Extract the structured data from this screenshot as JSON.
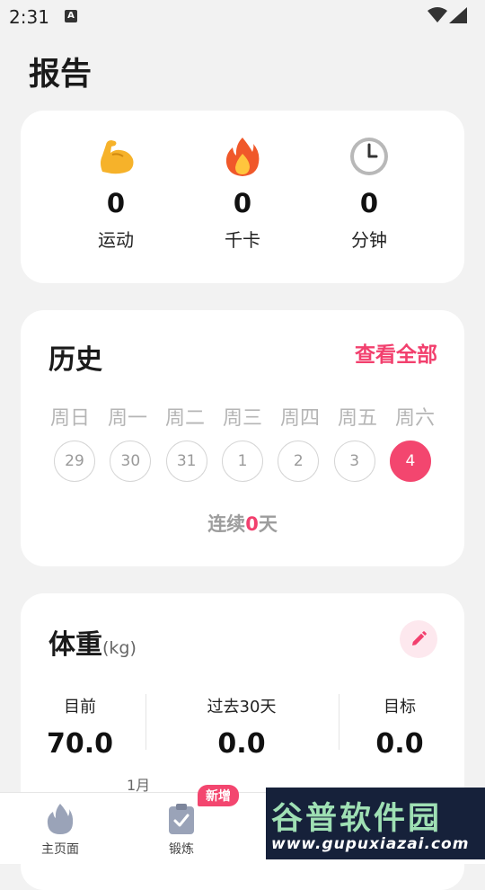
{
  "status_bar": {
    "time": "2:31",
    "notification_icon": "A"
  },
  "page": {
    "title": "报告"
  },
  "stats": [
    {
      "icon": "flexed-biceps-icon",
      "value": "0",
      "label": "运动"
    },
    {
      "icon": "fire-icon",
      "value": "0",
      "label": "千卡"
    },
    {
      "icon": "clock-icon",
      "value": "0",
      "label": "分钟"
    }
  ],
  "history": {
    "title": "历史",
    "view_all": "查看全部",
    "weekdays": [
      "周日",
      "周一",
      "周二",
      "周三",
      "周四",
      "周五",
      "周六"
    ],
    "days": [
      "29",
      "30",
      "31",
      "1",
      "2",
      "3",
      "4"
    ],
    "active_day_index": 6,
    "streak_prefix": "连续",
    "streak_count": "0",
    "streak_suffix": "天"
  },
  "weight": {
    "title": "体重",
    "unit": "(kg)",
    "columns": [
      {
        "label": "目前",
        "value": "70.0"
      },
      {
        "label": "过去30天",
        "value": "0.0"
      },
      {
        "label": "目标",
        "value": "0.0"
      }
    ],
    "chart_month": "1月"
  },
  "tabbar": {
    "tabs": [
      {
        "label": "主页面",
        "icon": "flame-icon"
      },
      {
        "label": "锻炼",
        "icon": "clipboard-check-icon"
      }
    ],
    "badge": "新增"
  },
  "watermark": {
    "title": "谷普软件园",
    "url": "www.gupuxiazai.com"
  },
  "colors": {
    "accent": "#f3466f",
    "background": "#f2f2f2",
    "card": "#ffffff"
  }
}
